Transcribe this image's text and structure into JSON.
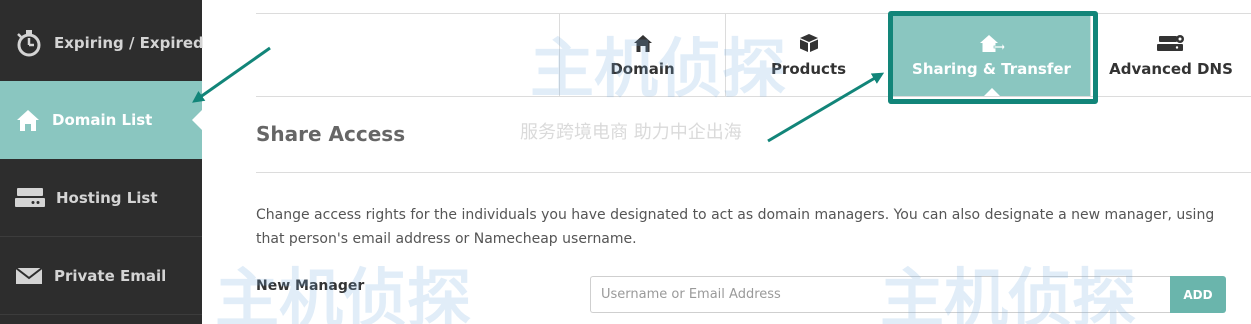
{
  "sidebar": {
    "items": [
      {
        "label": "Expiring / Expired",
        "icon": "stopwatch-icon"
      },
      {
        "label": "Domain List",
        "icon": "home-icon",
        "active": true
      },
      {
        "label": "Hosting List",
        "icon": "server-icon"
      },
      {
        "label": "Private Email",
        "icon": "envelope-icon"
      }
    ]
  },
  "tabs": [
    {
      "label": "Domain",
      "icon": "home-icon"
    },
    {
      "label": "Products",
      "icon": "box-icon"
    },
    {
      "label": "Sharing & Transfer",
      "icon": "home-arrow-icon",
      "active": true
    },
    {
      "label": "Advanced DNS",
      "icon": "server-gear-icon"
    }
  ],
  "main": {
    "title": "Share Access",
    "description": "Change access rights for the individuals you have designated to act as domain managers. You can also designate a new manager, using that person's email address or Namecheap username.",
    "new_manager": {
      "label": "New Manager",
      "placeholder": "Username or Email Address",
      "value": "",
      "button_label": "ADD"
    }
  },
  "watermark": {
    "brand": "主机侦探",
    "slogan": "服务跨境电商 助力中企出海"
  },
  "colors": {
    "sidebar_bg": "#2d2d2d",
    "accent": "#8ac6c0",
    "annotation": "#128579",
    "button": "#6ab5ac"
  }
}
